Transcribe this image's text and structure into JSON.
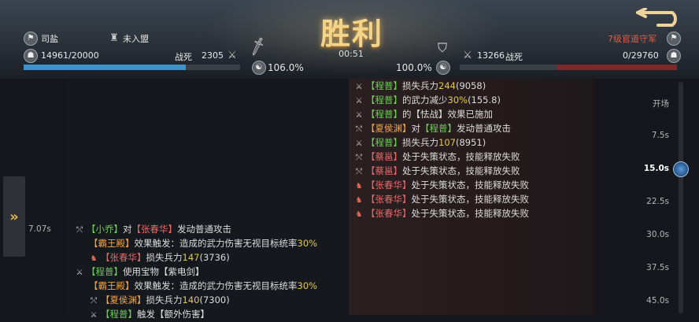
{
  "header": {
    "result_title": "胜利",
    "timer": "00:51",
    "left": {
      "player_name": "司盐",
      "alliance": "未入盟",
      "troops": "14961/20000",
      "troops_fraction": 0.748,
      "dead_label": "战死",
      "dead_count": "2305",
      "morale": "106.0%"
    },
    "right": {
      "player_name": "7级官道守军",
      "troops": "0/29760",
      "dead_count": "13266",
      "dead_label": "战死",
      "morale": "100.0%"
    }
  },
  "timeline": {
    "ticks": [
      "开场",
      "7.5s",
      "15.0s",
      "22.5s",
      "30.0s",
      "37.5s",
      "45.0s"
    ],
    "current_tick": "15.0s",
    "left_time": "7.07s"
  },
  "log_right": [
    {
      "icon": "swords",
      "parts": [
        [
          "g",
          "【程普】"
        ],
        [
          "w",
          "损失兵力"
        ],
        [
          "y",
          "244"
        ],
        [
          "w",
          "(9058)"
        ]
      ]
    },
    {
      "icon": "swords",
      "parts": [
        [
          "g",
          "【程普】"
        ],
        [
          "w",
          "的武力减少"
        ],
        [
          "y",
          "30%"
        ],
        [
          "w",
          "(155.8)"
        ]
      ]
    },
    {
      "icon": "swords",
      "parts": [
        [
          "g",
          "【程普】"
        ],
        [
          "w",
          "的【怯战】效果已施加"
        ]
      ]
    },
    {
      "icon": "bow",
      "parts": [
        [
          "o",
          "【夏侯渊】"
        ],
        [
          "w",
          "对"
        ],
        [
          "g",
          "【程普】"
        ],
        [
          "w",
          "发动普通攻击"
        ]
      ]
    },
    {
      "icon": "swords",
      "parts": [
        [
          "g",
          "【程普】"
        ],
        [
          "w",
          "损失兵力"
        ],
        [
          "y",
          "107"
        ],
        [
          "w",
          "(8951)"
        ]
      ]
    },
    {
      "icon": "bow",
      "parts": [
        [
          "r",
          "【蔡邕】"
        ],
        [
          "w",
          "处于失策状态，技能释放失败"
        ]
      ]
    },
    {
      "icon": "bow",
      "parts": [
        [
          "r",
          "【蔡邕】"
        ],
        [
          "w",
          "处于失策状态，技能释放失败"
        ]
      ]
    },
    {
      "icon": "horse",
      "parts": [
        [
          "r",
          "【张春华】"
        ],
        [
          "w",
          "处于失策状态，技能释放失败"
        ]
      ]
    },
    {
      "icon": "horse",
      "parts": [
        [
          "r",
          "【张春华】"
        ],
        [
          "w",
          "处于失策状态，技能释放失败"
        ]
      ]
    },
    {
      "icon": "horse",
      "parts": [
        [
          "r",
          "【张春华】"
        ],
        [
          "w",
          "处于失策状态，技能释放失败"
        ]
      ]
    }
  ],
  "log_left": [
    {
      "indent": 0,
      "icon": "bow",
      "parts": [
        [
          "g",
          "【小乔】"
        ],
        [
          "w",
          "对"
        ],
        [
          "r",
          "【张春华】"
        ],
        [
          "w",
          "发动普通攻击"
        ]
      ]
    },
    {
      "indent": 1,
      "icon": "",
      "parts": [
        [
          "o",
          "【霸王殿】"
        ],
        [
          "w",
          "效果触发：造成的武力伤害无视目标统率"
        ],
        [
          "y",
          "30%"
        ]
      ]
    },
    {
      "indent": 1,
      "icon": "horse",
      "parts": [
        [
          "r",
          "【张春华】"
        ],
        [
          "w",
          "损失兵力"
        ],
        [
          "y",
          "147"
        ],
        [
          "w",
          "(3736)"
        ]
      ]
    },
    {
      "indent": 0,
      "icon": "swords",
      "parts": [
        [
          "g",
          "【程普】"
        ],
        [
          "w",
          "使用宝物【紫电剑】"
        ]
      ]
    },
    {
      "indent": 1,
      "icon": "",
      "parts": [
        [
          "o",
          "【霸王殿】"
        ],
        [
          "w",
          "效果触发：造成的武力伤害无视目标统率"
        ],
        [
          "y",
          "30%"
        ]
      ]
    },
    {
      "indent": 1,
      "icon": "bow",
      "parts": [
        [
          "o",
          "【夏侯渊】"
        ],
        [
          "w",
          "损失兵力"
        ],
        [
          "y",
          "140"
        ],
        [
          "w",
          "(7300)"
        ]
      ]
    },
    {
      "indent": 1,
      "icon": "swords",
      "parts": [
        [
          "g",
          "【程普】"
        ],
        [
          "w",
          "触发【额外伤害】"
        ]
      ]
    }
  ],
  "icons": {
    "swords": "⚔",
    "bow": "⤲",
    "horse": "♞",
    "back": "back-arrow-icon",
    "expand": "double-chevron-right-icon"
  },
  "colors": {
    "green_name": "#6fce5a",
    "orange_name": "#f3a546",
    "red_name": "#e36a6a",
    "number": "#e4c94a",
    "troop_bar": "#3f92c9",
    "enemy_bar": "#7a2a2a"
  }
}
